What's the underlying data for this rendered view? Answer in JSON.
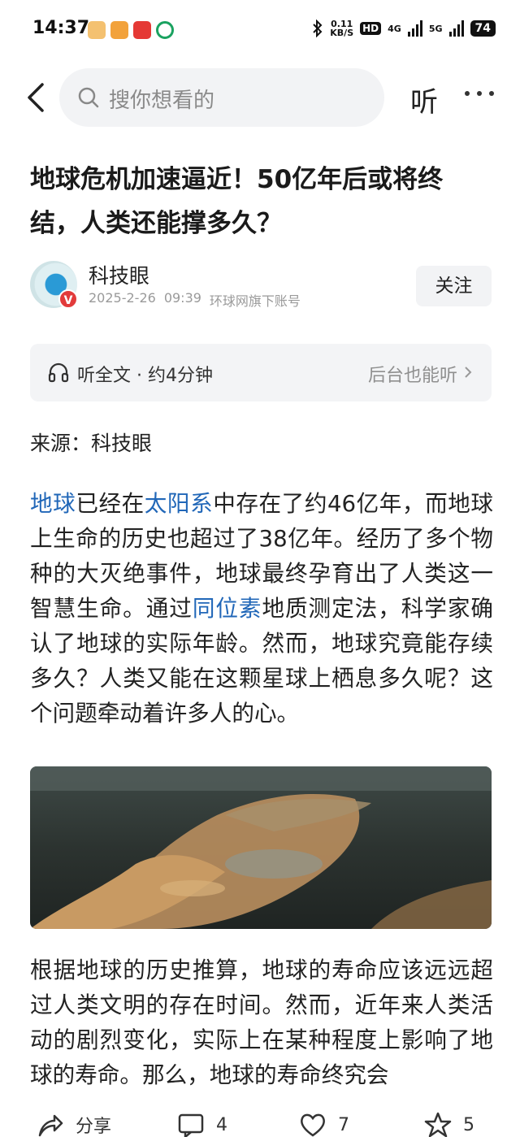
{
  "status_bar": {
    "time": "14:37",
    "speed_value": "0.11",
    "speed_unit": "KB/S",
    "hd": "HD",
    "net1": "4G",
    "net2": "5G",
    "battery": "74",
    "app_icons": [
      "reading-app-icon",
      "video-app-icon",
      "news-app-icon",
      "mobile-carrier-icon"
    ]
  },
  "nav": {
    "search_placeholder": "搜你想看的",
    "listen_label": "听"
  },
  "article": {
    "title": "地球危机加速逼近！50亿年后或将终结，人类还能撑多久？",
    "author": {
      "name": "科技眼",
      "date": "2025-2-26",
      "time": "09:39",
      "account": "环球网旗下账号",
      "verified_mark": "V"
    },
    "follow_label": "关注",
    "listen_bar": {
      "label": "听全文 · 约4分钟",
      "background_label": "后台也能听"
    },
    "source": "来源：科技眼",
    "para1": {
      "link1": "地球",
      "t1": "已经在",
      "link2": "太阳系",
      "t2": "中存在了约46亿年，而地球上生命的历史也超过了38亿年。经历了多个物种的大灭绝事件，地球最终孕育出了人类这一智慧生命。通过",
      "link3": "同位素",
      "t3": "地质测定法，科学家确认了地球的实际年龄。然而，地球究竟能存续多久？人类又能在这颗星球上栖息多久呢？这个问题牵动着许多人的心。"
    },
    "para2": "根据地球的历史推算，地球的寿命应该远远超过人类文明的存在时间。然而，近年来人类活动的剧烈变化，实际上在某种程度上影响了地球的寿命。那么，地球的寿命终究会"
  },
  "bottom_bar": {
    "share_label": "分享",
    "comments": "4",
    "likes": "7",
    "favorites": "5"
  }
}
